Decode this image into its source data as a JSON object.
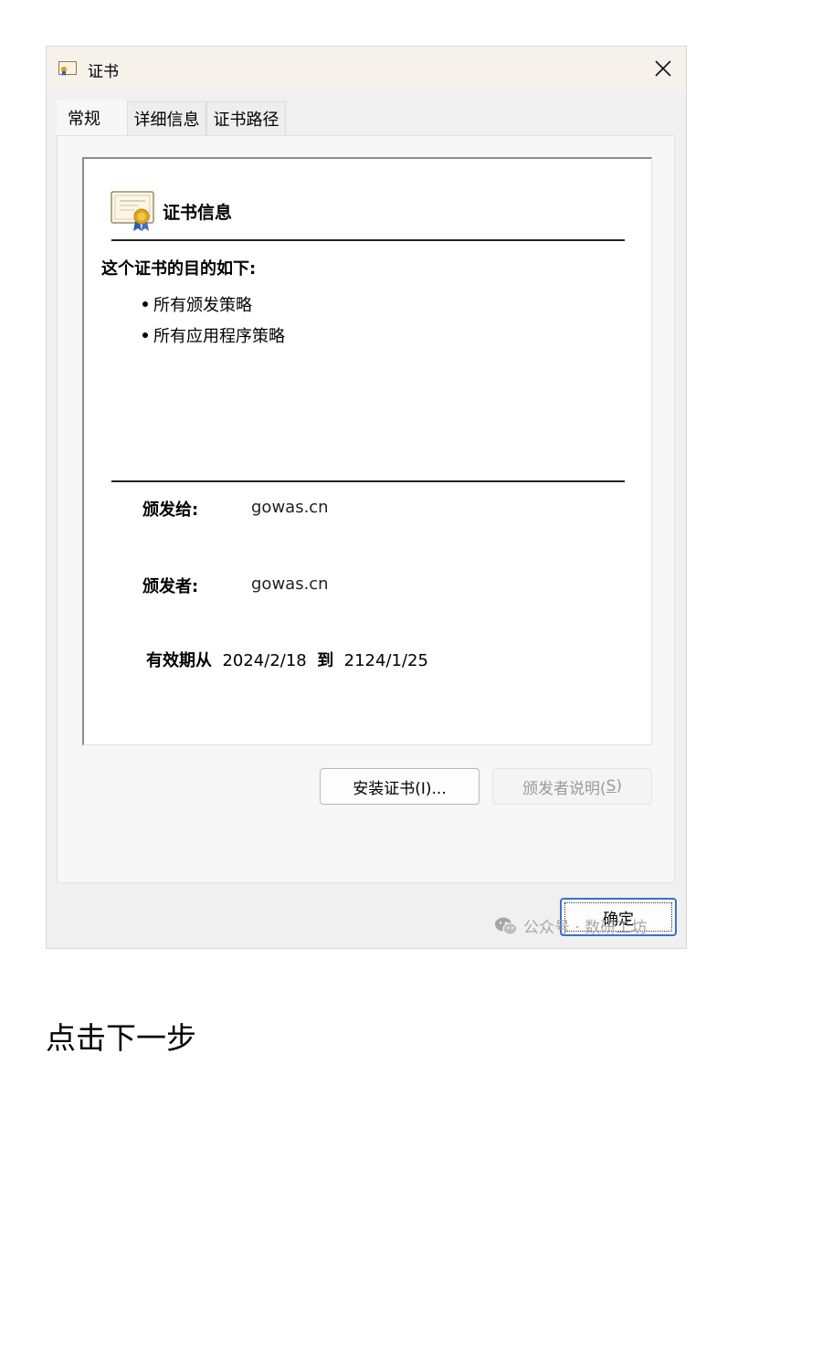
{
  "window": {
    "title": "证书",
    "tabs": [
      {
        "label": "常规",
        "active": true
      },
      {
        "label": "详细信息",
        "active": false
      },
      {
        "label": "证书路径",
        "active": false
      }
    ]
  },
  "cert": {
    "section_title": "证书信息",
    "purpose_heading": "这个证书的目的如下:",
    "purposes": [
      "所有颁发策略",
      "所有应用程序策略"
    ],
    "issued_to_label": "颁发给:",
    "issued_to_value": "gowas.cn",
    "issued_by_label": "颁发者:",
    "issued_by_value": "gowas.cn",
    "validity_label": "有效期从",
    "valid_from": "2024/2/18",
    "validity_to_label": "到",
    "valid_to": "2124/1/25"
  },
  "buttons": {
    "install": "安装证书(I)...",
    "issuer_statement_prefix": "颁发者说明(",
    "issuer_statement_key": "S",
    "issuer_statement_suffix": ")",
    "ok": "确定"
  },
  "watermark": "公众号 · 数研工坊",
  "caption": "点击下一步",
  "colors": {
    "titlebar": "#f7f1ec",
    "dialog_bg": "#f0f0f0",
    "ok_border": "#3a6fd0",
    "disabled_text": "#9a9a9a"
  }
}
